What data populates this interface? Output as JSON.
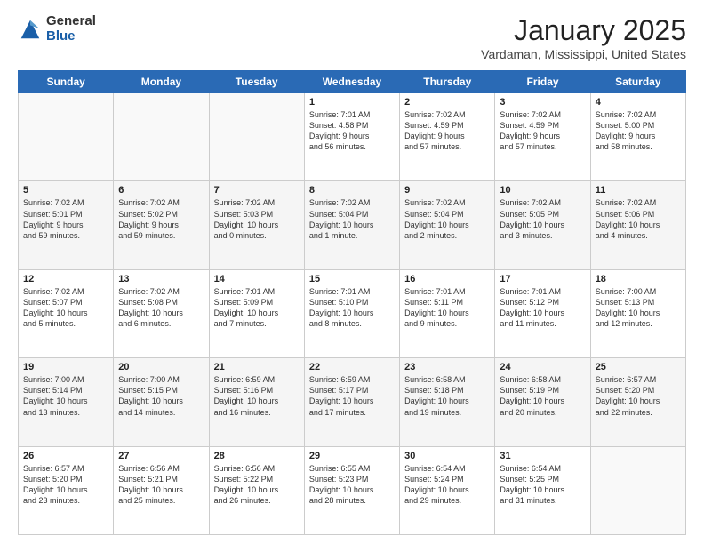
{
  "logo": {
    "general": "General",
    "blue": "Blue"
  },
  "header": {
    "month": "January 2025",
    "location": "Vardaman, Mississippi, United States"
  },
  "days": [
    "Sunday",
    "Monday",
    "Tuesday",
    "Wednesday",
    "Thursday",
    "Friday",
    "Saturday"
  ],
  "weeks": [
    [
      {
        "date": "",
        "info": ""
      },
      {
        "date": "",
        "info": ""
      },
      {
        "date": "",
        "info": ""
      },
      {
        "date": "1",
        "info": "Sunrise: 7:01 AM\nSunset: 4:58 PM\nDaylight: 9 hours\nand 56 minutes."
      },
      {
        "date": "2",
        "info": "Sunrise: 7:02 AM\nSunset: 4:59 PM\nDaylight: 9 hours\nand 57 minutes."
      },
      {
        "date": "3",
        "info": "Sunrise: 7:02 AM\nSunset: 4:59 PM\nDaylight: 9 hours\nand 57 minutes."
      },
      {
        "date": "4",
        "info": "Sunrise: 7:02 AM\nSunset: 5:00 PM\nDaylight: 9 hours\nand 58 minutes."
      }
    ],
    [
      {
        "date": "5",
        "info": "Sunrise: 7:02 AM\nSunset: 5:01 PM\nDaylight: 9 hours\nand 59 minutes."
      },
      {
        "date": "6",
        "info": "Sunrise: 7:02 AM\nSunset: 5:02 PM\nDaylight: 9 hours\nand 59 minutes."
      },
      {
        "date": "7",
        "info": "Sunrise: 7:02 AM\nSunset: 5:03 PM\nDaylight: 10 hours\nand 0 minutes."
      },
      {
        "date": "8",
        "info": "Sunrise: 7:02 AM\nSunset: 5:04 PM\nDaylight: 10 hours\nand 1 minute."
      },
      {
        "date": "9",
        "info": "Sunrise: 7:02 AM\nSunset: 5:04 PM\nDaylight: 10 hours\nand 2 minutes."
      },
      {
        "date": "10",
        "info": "Sunrise: 7:02 AM\nSunset: 5:05 PM\nDaylight: 10 hours\nand 3 minutes."
      },
      {
        "date": "11",
        "info": "Sunrise: 7:02 AM\nSunset: 5:06 PM\nDaylight: 10 hours\nand 4 minutes."
      }
    ],
    [
      {
        "date": "12",
        "info": "Sunrise: 7:02 AM\nSunset: 5:07 PM\nDaylight: 10 hours\nand 5 minutes."
      },
      {
        "date": "13",
        "info": "Sunrise: 7:02 AM\nSunset: 5:08 PM\nDaylight: 10 hours\nand 6 minutes."
      },
      {
        "date": "14",
        "info": "Sunrise: 7:01 AM\nSunset: 5:09 PM\nDaylight: 10 hours\nand 7 minutes."
      },
      {
        "date": "15",
        "info": "Sunrise: 7:01 AM\nSunset: 5:10 PM\nDaylight: 10 hours\nand 8 minutes."
      },
      {
        "date": "16",
        "info": "Sunrise: 7:01 AM\nSunset: 5:11 PM\nDaylight: 10 hours\nand 9 minutes."
      },
      {
        "date": "17",
        "info": "Sunrise: 7:01 AM\nSunset: 5:12 PM\nDaylight: 10 hours\nand 11 minutes."
      },
      {
        "date": "18",
        "info": "Sunrise: 7:00 AM\nSunset: 5:13 PM\nDaylight: 10 hours\nand 12 minutes."
      }
    ],
    [
      {
        "date": "19",
        "info": "Sunrise: 7:00 AM\nSunset: 5:14 PM\nDaylight: 10 hours\nand 13 minutes."
      },
      {
        "date": "20",
        "info": "Sunrise: 7:00 AM\nSunset: 5:15 PM\nDaylight: 10 hours\nand 14 minutes."
      },
      {
        "date": "21",
        "info": "Sunrise: 6:59 AM\nSunset: 5:16 PM\nDaylight: 10 hours\nand 16 minutes."
      },
      {
        "date": "22",
        "info": "Sunrise: 6:59 AM\nSunset: 5:17 PM\nDaylight: 10 hours\nand 17 minutes."
      },
      {
        "date": "23",
        "info": "Sunrise: 6:58 AM\nSunset: 5:18 PM\nDaylight: 10 hours\nand 19 minutes."
      },
      {
        "date": "24",
        "info": "Sunrise: 6:58 AM\nSunset: 5:19 PM\nDaylight: 10 hours\nand 20 minutes."
      },
      {
        "date": "25",
        "info": "Sunrise: 6:57 AM\nSunset: 5:20 PM\nDaylight: 10 hours\nand 22 minutes."
      }
    ],
    [
      {
        "date": "26",
        "info": "Sunrise: 6:57 AM\nSunset: 5:20 PM\nDaylight: 10 hours\nand 23 minutes."
      },
      {
        "date": "27",
        "info": "Sunrise: 6:56 AM\nSunset: 5:21 PM\nDaylight: 10 hours\nand 25 minutes."
      },
      {
        "date": "28",
        "info": "Sunrise: 6:56 AM\nSunset: 5:22 PM\nDaylight: 10 hours\nand 26 minutes."
      },
      {
        "date": "29",
        "info": "Sunrise: 6:55 AM\nSunset: 5:23 PM\nDaylight: 10 hours\nand 28 minutes."
      },
      {
        "date": "30",
        "info": "Sunrise: 6:54 AM\nSunset: 5:24 PM\nDaylight: 10 hours\nand 29 minutes."
      },
      {
        "date": "31",
        "info": "Sunrise: 6:54 AM\nSunset: 5:25 PM\nDaylight: 10 hours\nand 31 minutes."
      },
      {
        "date": "",
        "info": ""
      }
    ]
  ]
}
